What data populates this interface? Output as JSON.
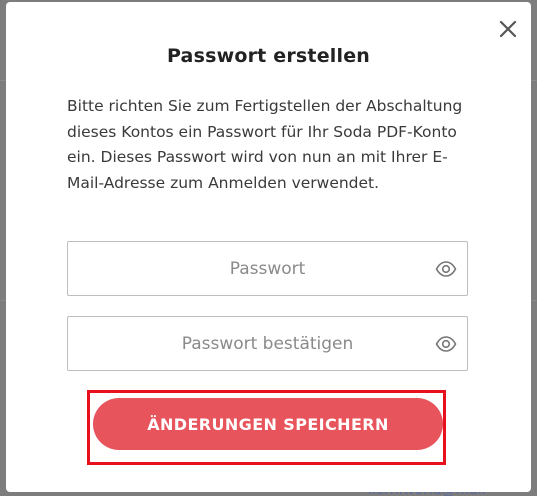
{
  "modal": {
    "title": "Passwort erstellen",
    "description": "Bitte richten Sie zum Fertigstellen der Abschaltung dieses Kontos ein Passwort für Ihr Soda PDF-Konto ein. Dieses Passwort wird von nun an mit Ihrer E-Mail-Adresse zum Anmelden verwendet.",
    "close_icon": "close-icon",
    "password_field": {
      "placeholder": "Passwort",
      "value": "",
      "icon": "eye-icon"
    },
    "confirm_field": {
      "placeholder": "Passwort bestätigen",
      "value": "",
      "icon": "eye-icon"
    },
    "save_label": "ÄNDERUNGEN SPEICHERN"
  },
  "background": {
    "partial_text": "kern.world@mail"
  },
  "colors": {
    "primary_button": "#e8545c",
    "highlight_border": "#e8101c",
    "overlay": "#7d7d7d"
  }
}
